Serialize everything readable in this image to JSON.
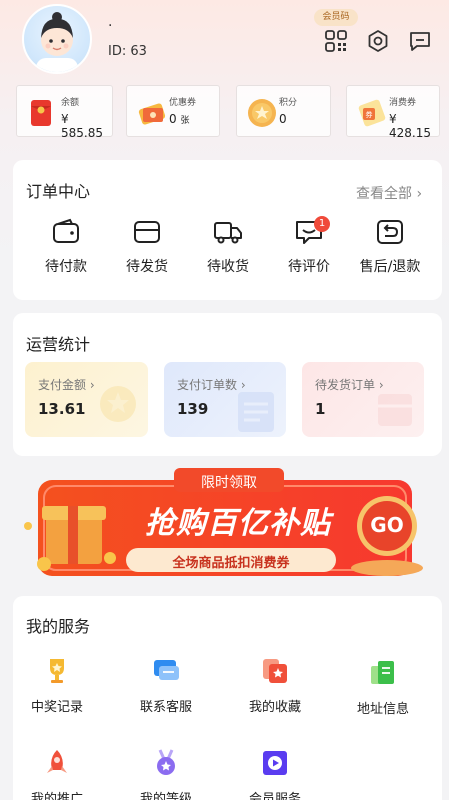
{
  "profile": {
    "name": "·",
    "id_label": "ID: 63",
    "vip_badge": "会员码"
  },
  "header_icons": [
    "qr-code-icon",
    "settings-icon",
    "message-icon"
  ],
  "assets": [
    {
      "label": "余额",
      "value": "¥ 585.85",
      "icon": "red-envelope-icon"
    },
    {
      "label": "优惠券",
      "value": "0",
      "unit": "张",
      "icon": "coupon-icon"
    },
    {
      "label": "积分",
      "value": "0",
      "icon": "points-coin-icon"
    },
    {
      "label": "消费券",
      "value": "¥ 428.15",
      "icon": "voucher-icon"
    }
  ],
  "orders": {
    "title": "订单中心",
    "view_all": "查看全部",
    "items": [
      {
        "label": "待付款",
        "icon": "wallet-icon"
      },
      {
        "label": "待发货",
        "icon": "box-icon"
      },
      {
        "label": "待收货",
        "icon": "truck-icon"
      },
      {
        "label": "待评价",
        "icon": "comment-icon",
        "badge": "1"
      },
      {
        "label": "售后/退款",
        "icon": "return-icon"
      }
    ]
  },
  "stats": {
    "title": "运营统计",
    "items": [
      {
        "label": "支付金额",
        "value": "13.61",
        "color": "#fdf3d6"
      },
      {
        "label": "支付订单数",
        "value": "139",
        "color": "#e4ecfb"
      },
      {
        "label": "待发货订单",
        "value": "1",
        "color": "#fdeaea"
      }
    ]
  },
  "banner": {
    "tag": "限时领取",
    "headline": "抢购百亿补贴",
    "sub": "全场商品抵扣消费券",
    "go": "GO"
  },
  "services": {
    "title": "我的服务",
    "items": [
      {
        "label": "中奖记录",
        "icon": "trophy-icon"
      },
      {
        "label": "联系客服",
        "icon": "chat-icon"
      },
      {
        "label": "我的收藏",
        "icon": "favorite-icon"
      },
      {
        "label": "地址信息",
        "icon": "address-icon"
      },
      {
        "label": "我的推广",
        "icon": "rocket-icon"
      },
      {
        "label": "我的等级",
        "icon": "medal-icon"
      },
      {
        "label": "会员服务",
        "icon": "video-icon"
      }
    ]
  },
  "colors": {
    "accent_red": "#f03a2e",
    "badge_red": "#f04a3a"
  }
}
